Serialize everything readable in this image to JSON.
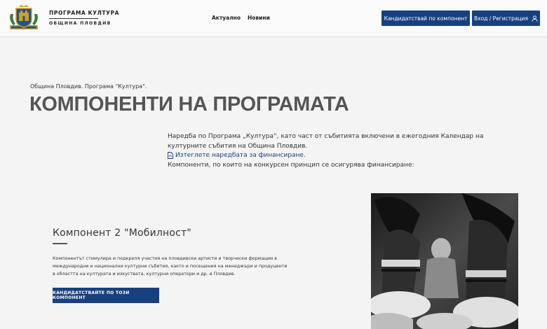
{
  "header": {
    "brand_title": "ПРОГРАМА КУЛТУРА",
    "brand_subtitle": "ОБЩИНА ПЛОВДИВ",
    "nav": [
      {
        "label": "Актуално"
      },
      {
        "label": "Новини"
      }
    ],
    "apply_button": "Кандидатствай по компонент",
    "login_button": "Вход / Регистрация",
    "login_icon": "user-icon",
    "accent_color": "#17407f"
  },
  "main": {
    "breadcrumb": "Община Пловдив. Програма \"Култура\".",
    "title": "КОМПОНЕНТИ НА ПРОГРАМАТА",
    "intro_text": "Наредба по Програма „Култура“, като част от събитията включени в ежегодния Календар на културните събития на Община Пловдив.",
    "download_link": "Изтеглете наредбата за финансиране.",
    "download_icon": "pdf-icon",
    "components_intro": "Компоненти, по които на конкурсен принцип се осигурява финансиране:"
  },
  "component": {
    "title": "Компонент 2 \"Мобилност\"",
    "description": "Компонентът стимулира и подкрепя участия на пловдивски артисти и творчески формации в международни и национални културни събития, както и посещения на мениджъри и продуценти в областта на културата и изкуствата, културни оператори и др. в Пловдив.",
    "apply_button": "КАНДИДАТСТВАЙТЕ ПО ТОЗИ КОМПОНЕНТ",
    "image_subject": "folk-dancers-photo"
  }
}
